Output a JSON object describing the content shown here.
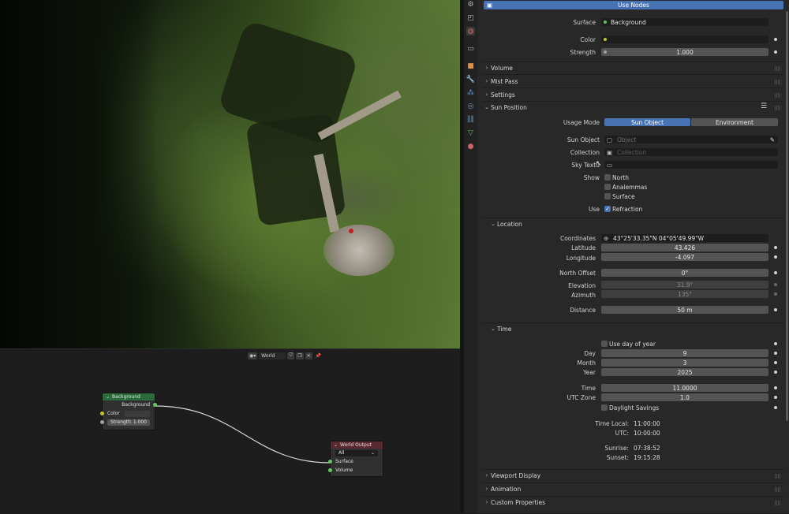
{
  "node_editor": {
    "world_label": "World",
    "background_node": {
      "title": "Background",
      "output": "Background",
      "color_label": "Color",
      "strength_label": "Strength",
      "strength_value": "1.000"
    },
    "output_node": {
      "title": "World Output",
      "target": "All",
      "surface": "Surface",
      "volume": "Volume"
    }
  },
  "properties": {
    "use_nodes": "Use Nodes",
    "surface_label": "Surface",
    "surface_value": "Background",
    "color_label": "Color",
    "strength_label": "Strength",
    "strength_value": "1.000",
    "panels": {
      "volume": "Volume",
      "mist_pass": "Mist Pass",
      "settings": "Settings",
      "sun_position": "Sun Position",
      "location": "Location",
      "time": "Time",
      "viewport_display": "Viewport Display",
      "animation": "Animation",
      "custom_properties": "Custom Properties"
    },
    "sun": {
      "usage_mode_label": "Usage Mode",
      "usage_sun_object": "Sun Object",
      "usage_environment": "Environment",
      "sun_object_label": "Sun Object",
      "sun_object_placeholder": "Object",
      "collection_label": "Collection",
      "collection_placeholder": "Collection",
      "sky_texture_label": "Sky Textu",
      "show_label": "Show",
      "show_north": "North",
      "show_analemmas": "Analemmas",
      "show_surface": "Surface",
      "use_label": "Use",
      "use_refraction": "Refraction"
    },
    "location": {
      "coordinates_label": "Coordinates",
      "coordinates_value": "43°25'33.35\"N 04°05'49.99\"W",
      "latitude_label": "Latitude",
      "latitude_value": "43.426",
      "longitude_label": "Longitude",
      "longitude_value": "-4.097",
      "north_offset_label": "North Offset",
      "north_offset_value": "0°",
      "elevation_label": "Elevation",
      "elevation_value": "31.9°",
      "azimuth_label": "Azimuth",
      "azimuth_value": "135°",
      "distance_label": "Distance",
      "distance_value": "50 m"
    },
    "time": {
      "use_day_of_year": "Use day of year",
      "day_label": "Day",
      "day_value": "9",
      "month_label": "Month",
      "month_value": "3",
      "year_label": "Year",
      "year_value": "2025",
      "time_label": "Time",
      "time_value": "11.0000",
      "utc_zone_label": "UTC Zone",
      "utc_zone_value": "1.0",
      "daylight_savings": "Daylight Savings",
      "time_local_label": "Time Local:",
      "time_local_value": "11:00:00",
      "utc_label": "UTC:",
      "utc_value": "10:00:00",
      "sunrise_label": "Sunrise:",
      "sunrise_value": "07:38:52",
      "sunset_label": "Sunset:",
      "sunset_value": "19:15:28"
    }
  },
  "colors": {
    "accent_blue": "#4772b3",
    "background_node_header": "#2b6b3b",
    "output_node_header": "#5a2a33"
  }
}
